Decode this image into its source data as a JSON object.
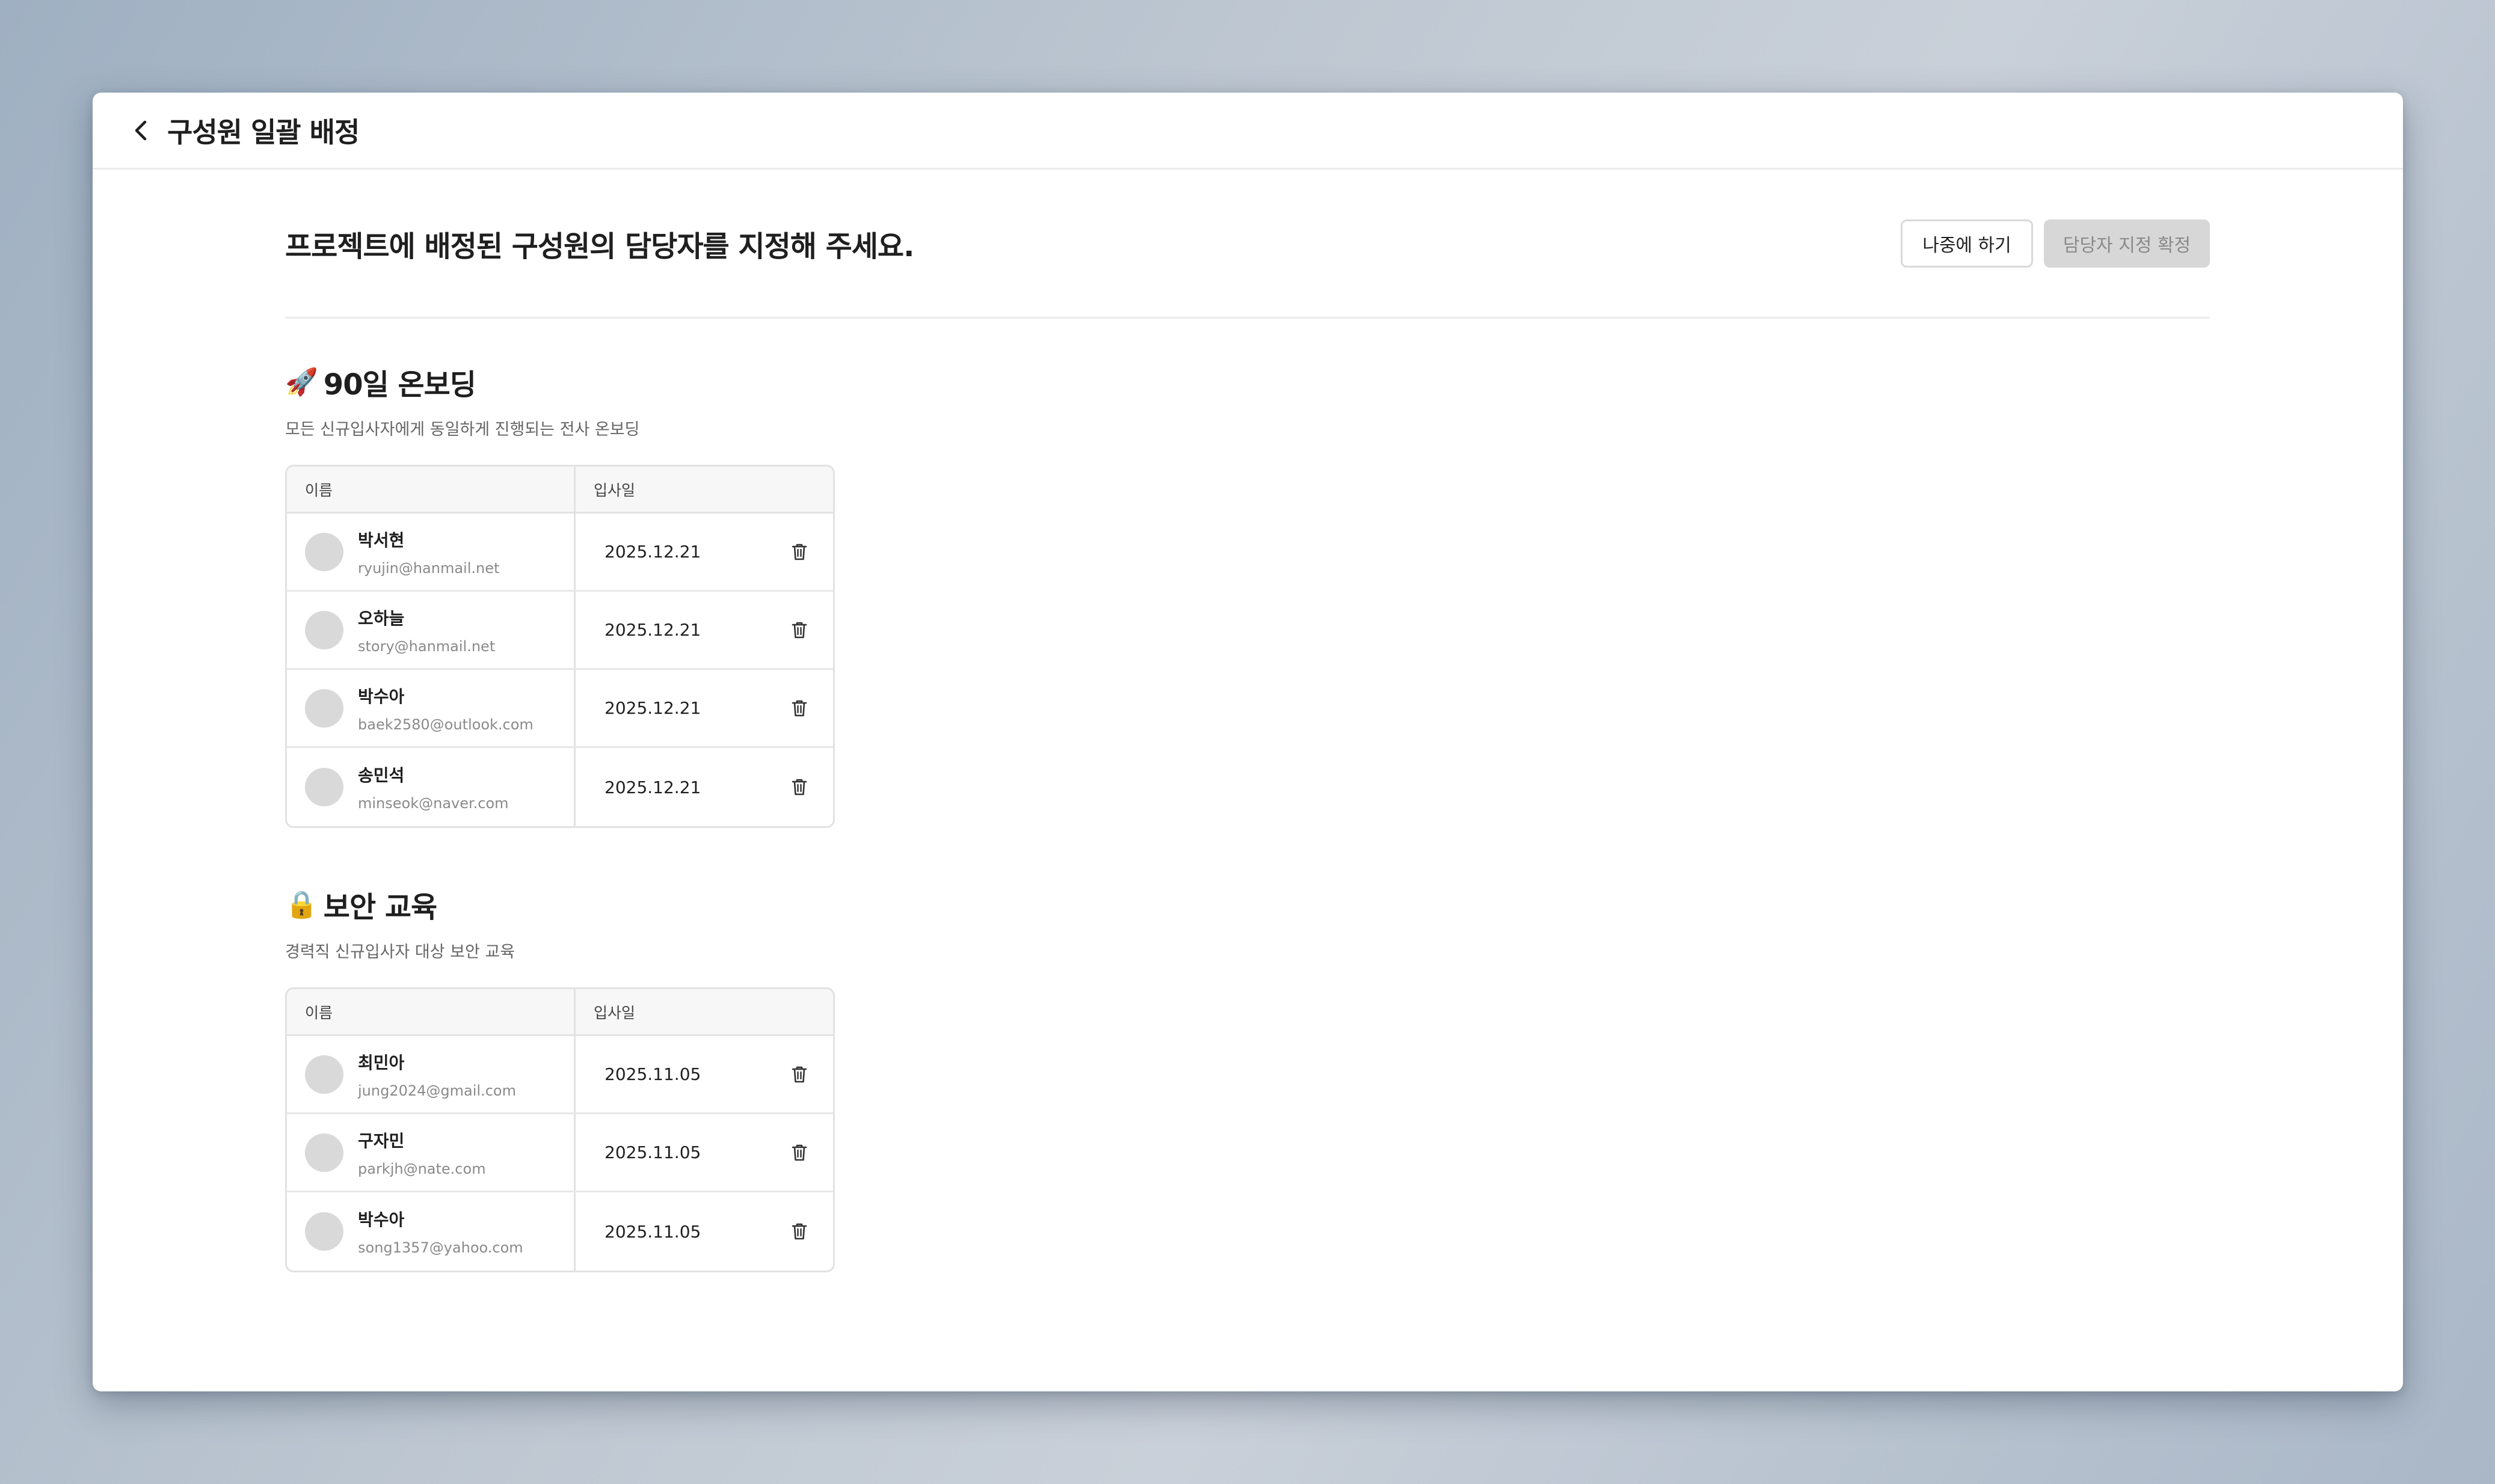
{
  "page": {
    "title": "구성원 일괄 배정",
    "heading": "프로젝트에 배정된 구성원의 담당자를 지정해 주세요.",
    "buttons": {
      "later": "나중에 하기",
      "confirm": "담당자 지정 확정"
    }
  },
  "table_headers": {
    "name": "이름",
    "join_date": "입사일"
  },
  "sections": [
    {
      "emoji": "🚀",
      "title": "90일 온보딩",
      "description": "모든 신규입사자에게 동일하게 진행되는 전사 온보딩",
      "members": [
        {
          "name": "박서현",
          "email": "ryujin@hanmail.net",
          "date": "2025.12.21"
        },
        {
          "name": "오하늘",
          "email": "story@hanmail.net",
          "date": "2025.12.21"
        },
        {
          "name": "박수아",
          "email": "baek2580@outlook.com",
          "date": "2025.12.21"
        },
        {
          "name": "송민석",
          "email": "minseok@naver.com",
          "date": "2025.12.21"
        }
      ]
    },
    {
      "emoji": "🔒",
      "title": "보안 교육",
      "description": "경력직 신규입사자 대상 보안 교육",
      "members": [
        {
          "name": "최민아",
          "email": "jung2024@gmail.com",
          "date": "2025.11.05"
        },
        {
          "name": "구자민",
          "email": "parkjh@nate.com",
          "date": "2025.11.05"
        },
        {
          "name": "박수아",
          "email": "song1357@yahoo.com",
          "date": "2025.11.05"
        }
      ]
    }
  ],
  "icons": {
    "back": "chevron-left-icon",
    "delete": "trash-icon"
  }
}
